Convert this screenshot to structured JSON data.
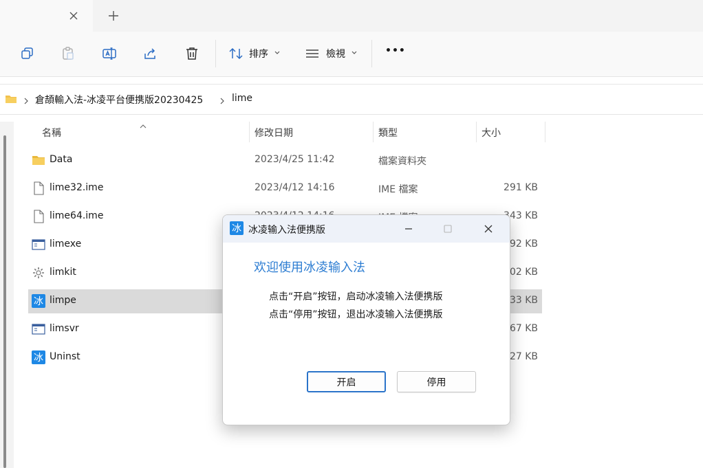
{
  "toolbar": {
    "sort_label": "排序",
    "view_label": "檢視",
    "more_label": "•••"
  },
  "breadcrumb": {
    "items": [
      "倉頡輸入法-冰凌平台便携版20230425",
      "lime"
    ]
  },
  "columns": {
    "name": "名稱",
    "modified": "修改日期",
    "type": "類型",
    "size": "大小"
  },
  "files": [
    {
      "name": "Data",
      "date": "2023/4/25 11:42",
      "type": "檔案資料夾",
      "size": "",
      "icon": "folder-icon"
    },
    {
      "name": "lime32.ime",
      "date": "2023/4/12 14:16",
      "type": "IME 檔案",
      "size": "291 KB",
      "icon": "file-icon"
    },
    {
      "name": "lime64.ime",
      "date": "2023/4/12 14:16",
      "type": "IME 檔案",
      "size": "343 KB",
      "icon": "file-icon"
    },
    {
      "name": "limexe",
      "date": "",
      "type": "",
      "size": "92 KB",
      "icon": "app-window-icon"
    },
    {
      "name": "limkit",
      "date": "",
      "type": "",
      "size": "502 KB",
      "icon": "gear-icon"
    },
    {
      "name": "limpe",
      "date": "",
      "type": "",
      "size": "33 KB",
      "icon": "ice-app-icon"
    },
    {
      "name": "limsvr",
      "date": "",
      "type": "",
      "size": "67 KB",
      "icon": "app-window-icon"
    },
    {
      "name": "Uninst",
      "date": "",
      "type": "",
      "size": "27 KB",
      "icon": "ice-app-icon"
    }
  ],
  "dialog": {
    "title": "冰凌输入法便携版",
    "icon_glyph": "冰",
    "heading": "欢迎使用冰凌输入法",
    "line1": "点击“开启”按钮，启动冰凌输入法便携版",
    "line2": "点击“停用”按钮，退出冰凌输入法便携版",
    "start_label": "开启",
    "stop_label": "停用"
  },
  "colors": {
    "accent": "#2d7dd2",
    "selection": "#dadada",
    "folder": "#f2c14e"
  }
}
